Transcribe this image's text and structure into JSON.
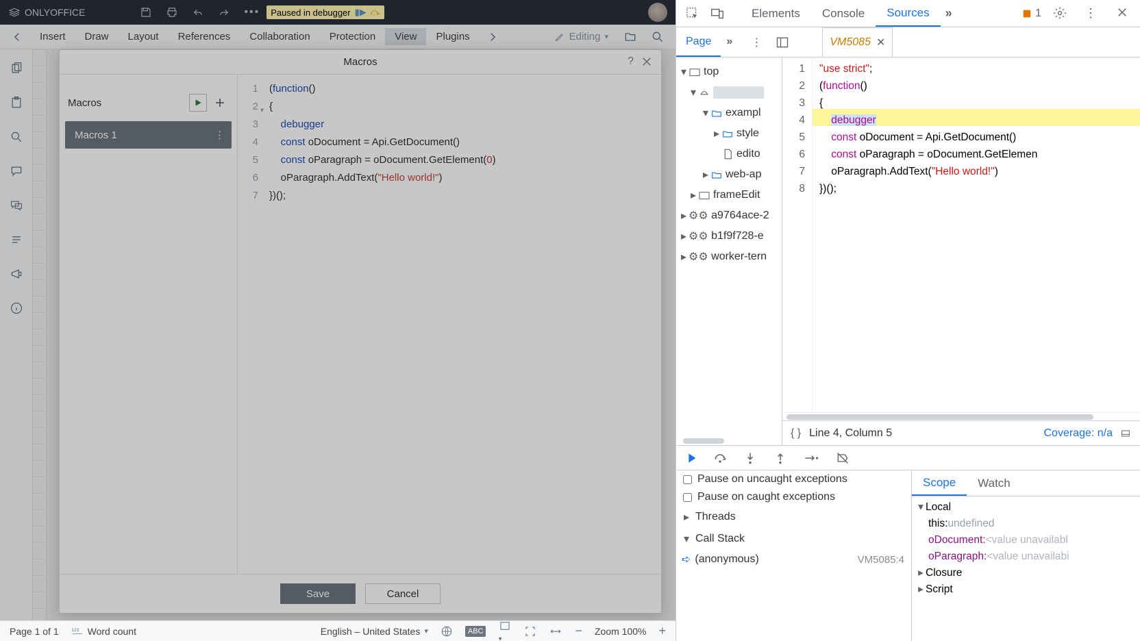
{
  "onlyoffice": {
    "brand": "ONLYOFFICE",
    "debugger_badge": "Paused in debugger",
    "menus": [
      "Insert",
      "Draw",
      "Layout",
      "References",
      "Collaboration",
      "Protection",
      "View",
      "Plugins"
    ],
    "active_menu": "View",
    "editing_label": "Editing",
    "status": {
      "page": "Page 1 of 1",
      "wordcount": "Word count",
      "language": "English – United States",
      "zoom": "Zoom 100%"
    }
  },
  "macros": {
    "title": "Macros",
    "list_header": "Macros",
    "items": [
      "Macros 1"
    ],
    "save": "Save",
    "cancel": "Cancel",
    "code_lines": [
      {
        "n": 1,
        "raw": "(function()"
      },
      {
        "n": 2,
        "raw": "{",
        "fold": true
      },
      {
        "n": 3,
        "raw": "    debugger",
        "warn": true
      },
      {
        "n": 4,
        "raw": "    const oDocument = Api.GetDocument()",
        "info": true
      },
      {
        "n": 5,
        "raw": "    const oParagraph = oDocument.GetElement(0)",
        "info": true
      },
      {
        "n": 6,
        "raw": "    oParagraph.AddText(\"Hello world!\")",
        "info": true
      },
      {
        "n": 7,
        "raw": "})();"
      }
    ]
  },
  "devtools": {
    "tabs": [
      "Elements",
      "Console",
      "Sources"
    ],
    "active_tab": "Sources",
    "issue_count": "1",
    "nav_tab": "Page",
    "source_tab": "VM5085",
    "tree": {
      "top": "top",
      "exampl": "exampl",
      "style": "style",
      "edito": "edito",
      "webap": "web-ap",
      "frameEdit": "frameEdit",
      "a97": "a9764ace-2",
      "b1f": "b1f9f728-e",
      "worker": "worker-tern"
    },
    "code": {
      "lines": [
        "\"use strict\";",
        "(function()",
        "{",
        "    debugger",
        "    const oDocument = Api.GetDocument()",
        "    const oParagraph = oDocument.GetElemen",
        "    oParagraph.AddText(\"Hello world!\")",
        "})();"
      ],
      "highlight_line": 4
    },
    "cursor_status": "Line 4, Column 5",
    "coverage": "Coverage: n/a",
    "pause_uncaught": "Pause on uncaught exceptions",
    "pause_caught": "Pause on caught exceptions",
    "section_threads": "Threads",
    "section_callstack": "Call Stack",
    "stack_frame": "(anonymous)",
    "stack_loc": "VM5085:4",
    "scope_tabs": [
      "Scope",
      "Watch"
    ],
    "scope": {
      "local": "Local",
      "this": "this:",
      "this_val": "undefined",
      "oDocument": "oDocument:",
      "oDocument_val": "<value unavailabl",
      "oParagraph": "oParagraph:",
      "oParagraph_val": "<value unavailabi",
      "closure": "Closure",
      "script": "Script"
    }
  }
}
